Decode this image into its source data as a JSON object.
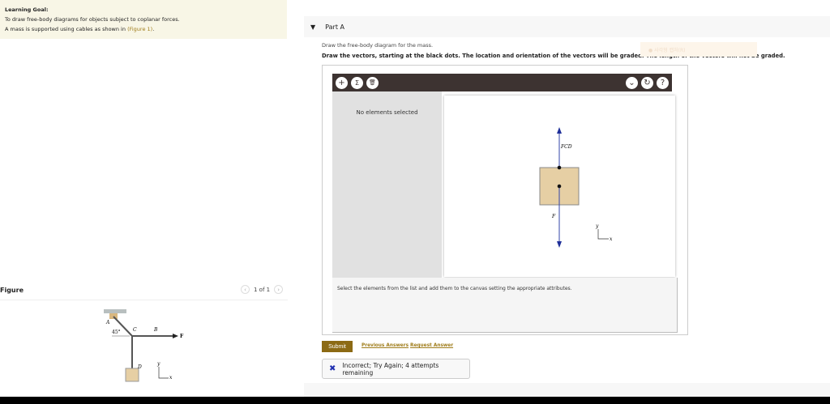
{
  "learning_goal": {
    "title": "Learning Goal:",
    "line1": "To draw free-body diagrams for objects subject to coplanar forces.",
    "line2_prefix": "A mass is supported using cables as shown in ",
    "figure_link": "(Figure 1)",
    "line2_suffix": "."
  },
  "figure": {
    "label": "Figure",
    "pager": "1 of 1",
    "labels": {
      "A": "A",
      "B": "B",
      "C": "C",
      "D": "D",
      "F": "F",
      "angle": "45°",
      "y": "y",
      "x": "x"
    }
  },
  "part": {
    "title": "Part A",
    "instruction1": "Draw the free-body diagram for the mass.",
    "instruction2": "Draw the vectors, starting at the black dots. The location and orientation of the vectors will be graded. The length of the vectors will not be graded."
  },
  "overlay_text": "● 사각형 캡처(R)",
  "tool": {
    "add": "+",
    "sum": "Σ",
    "delete": "🗑",
    "menu": "⌄",
    "reset": "↻",
    "help": "?",
    "no_selection": "No elements selected",
    "hint": "Select the elements from the list and add them to the canvas setting the appropriate attributes.",
    "vectors": {
      "FCD": "FCD",
      "F": "F"
    },
    "axes": {
      "x": "x",
      "y": "y"
    }
  },
  "actions": {
    "submit": "Submit",
    "previous": "Previous Answers",
    "request": "Request Answer"
  },
  "feedback": {
    "icon": "✖",
    "text": "Incorrect; Try Again; 4 attempts remaining"
  }
}
